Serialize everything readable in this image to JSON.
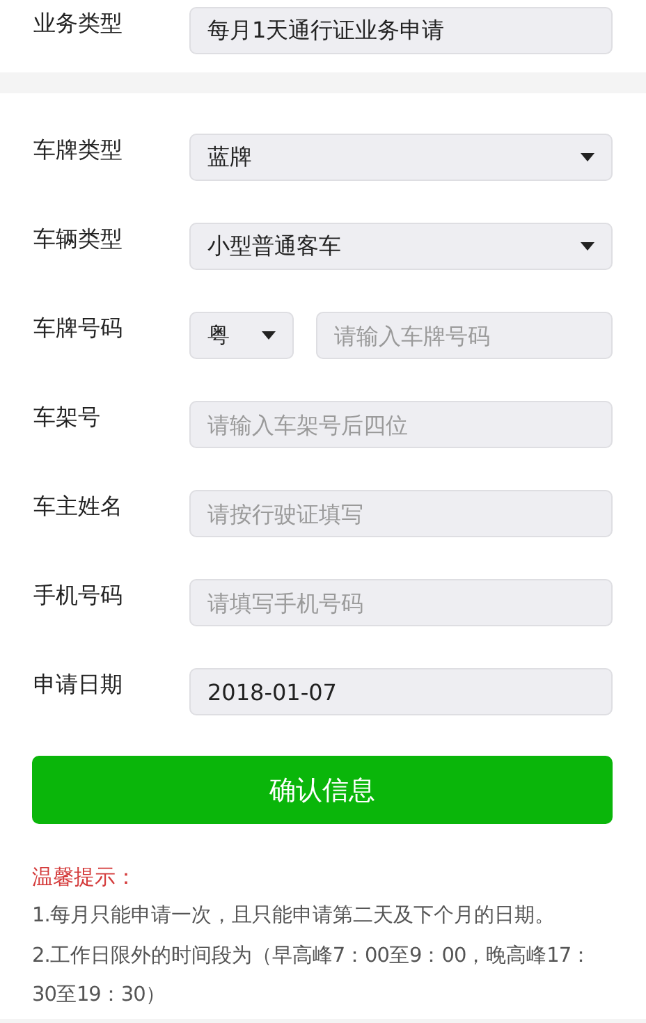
{
  "business": {
    "label": "业务类型",
    "value": "每月1天通行证业务申请"
  },
  "fields": [
    {
      "kind": "select",
      "label": "车牌类型",
      "value": "蓝牌"
    },
    {
      "kind": "select",
      "label": "车辆类型",
      "value": "小型普通客车"
    },
    {
      "kind": "plate",
      "label": "车牌号码",
      "prefix": "粤",
      "placeholder": "请输入车牌号码"
    },
    {
      "kind": "input",
      "label": "车架号",
      "placeholder": "请输入车架号后四位"
    },
    {
      "kind": "input",
      "label": "车主姓名",
      "placeholder": "请按行驶证填写"
    },
    {
      "kind": "input",
      "label": "手机号码",
      "placeholder": "请填写手机号码"
    },
    {
      "kind": "text",
      "label": "申请日期",
      "value": "2018-01-07"
    }
  ],
  "confirm_button": "确认信息",
  "notes": {
    "title": "温馨提示：",
    "lines": [
      "1.每月只能申请一次，且只能申请第二天及下个月的日期。",
      "2.工作日限外的时间段为（早高峰7：00至9：00，晚高峰17：30至19：30）"
    ]
  }
}
